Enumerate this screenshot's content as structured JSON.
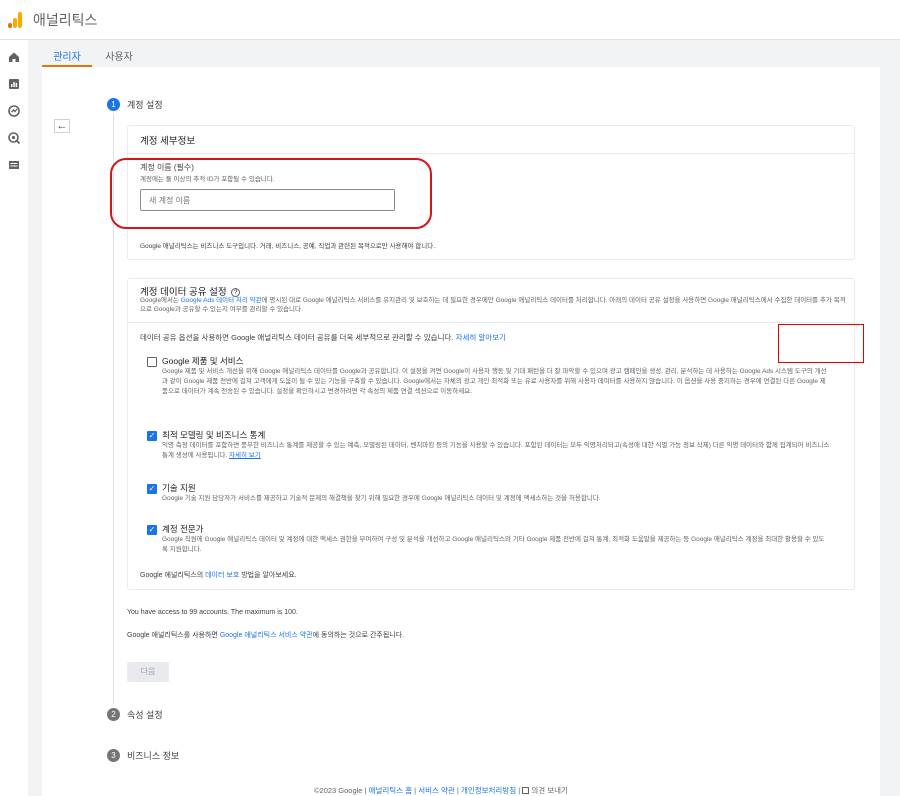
{
  "header": {
    "app_title": "애널리틱스"
  },
  "rail": {
    "icons": [
      "home-icon",
      "reports-icon",
      "explore-icon",
      "advertising-icon",
      "configure-icon",
      "settings-icon"
    ]
  },
  "tabs": [
    {
      "label": "관리자"
    },
    {
      "label": "사용자"
    }
  ],
  "steps": [
    {
      "number": "1",
      "label": "계정 설정"
    },
    {
      "number": "2",
      "label": "속성 설정"
    },
    {
      "number": "3",
      "label": "비즈니스 정보"
    }
  ],
  "account_details": {
    "title": "계정 세부정보",
    "name_label": "계정 이름 (필수)",
    "name_hint": "계정에는 둘 이상의 추적 ID가 포함될 수 있습니다.",
    "name_placeholder": "새 계정 이름",
    "footnote": "Google 애널리틱스는 비즈니스 도구입니다. 거래, 비즈니스, 공예, 직업과 관련된 목적으로만 사용해야 합니다."
  },
  "sharing": {
    "title": "계정 데이터 공유 설정",
    "intro_a": "Google에서는 ",
    "intro_link": "Google Ads 데이터 처리 약관",
    "intro_b": "에 명시된 대로 Google 애널리틱스 서비스를 유지관리 및 보호하는 데 필요한 경우에만 Google 애널리틱스 데이터를 처리합니다. 아래의 데이터 공유 설정을 사용하면 Google 애널리틱스에서 수집한 데이터를 추가 목적으로 Google과 공유할 수 있는지 여부를 관리할 수 있습니다.",
    "manage_text": "데이터 공유 옵션을 사용하면 Google 애널리틱스 데이터 공유를 더욱 세부적으로 관리할 수 있습니다. ",
    "manage_link": "자세히 알아보기",
    "options": [
      {
        "title": "Google 제품 및 서비스",
        "checked": false,
        "desc": "Google 제품 및 서비스 개선을 위해 Google 애널리틱스 데이터를 Google과 공유합니다. 이 설정을 켜면 Google이 사용자 행동 및 기대 패턴을 더 잘 파악할 수 있으며 광고 캠페인을 생성, 관리, 분석하는 데 사용하는 Google Ads 시스템 도구의 개선과 같이 Google 제품 전반에 걸쳐 고객에게 도움이 될 수 있는 기능을 구축할 수 있습니다. Google에서는 자체의 광고 개인 최적화 또는 유료 사용자를 위해 사용자 데이터를 사용하지 않습니다. 이 옵션을 사용 중지하는 경우에 연결된 다른 Google 제품으로 데이터가 계속 전송된 수 있습니다. 설정을 확인하시고 변경하려면 각 속성의 제품 연결 섹션으로 이동하세요."
      },
      {
        "title": "최적 모델링 및 비즈니스 통계",
        "checked": true,
        "desc_a": "익명 측정 데이터를 포함하면 풍부한 비즈니스 통계를 제공할 수 있는 예측, 모델링된 데이터, 벤치마킹 등의 기능을 사용할 수 있습니다. 포함된 데이터는 모두 익명처리되고(속성에 대한 식별 가능 정보 삭제) 다른 익명 데이터와 함께 집계되어 비즈니스 통계 생성에 사용됩니다. ",
        "desc_link": "자세히 보기"
      },
      {
        "title": "기술 지원",
        "checked": true,
        "desc": "Google 기술 지원 담당자가 서비스를 제공하고 기술적 문제의 해결책을 찾기 위해 필요한 경우에 Google 애널리틱스 데이터 및 계정에 액세스하는 것을 허용합니다."
      },
      {
        "title": "계정 전문가",
        "checked": true,
        "desc": "Google 직원에 Google 애널리틱스 데이터 및 계정에 대한 액세스 권한을 부여하여 구성 및 분석을 개선하고 Google 애널리틱스와 기타 Google 제품 전반에 걸쳐 통계, 최적화 도움말을 제공하는 등 Google 애널리틱스 계정을 최대한 활용할 수 있도록 지원합니다."
      }
    ],
    "protect_a": "Google 애널리틱스의 ",
    "protect_link": "데이터 보호",
    "protect_b": " 방법을 알아보세요."
  },
  "access_note": "You have access to 99 accounts. The maximum is 100.",
  "terms_a": "Google 애널리틱스를 사용하면 ",
  "terms_link": "Google 애널리틱스 서비스 약관",
  "terms_b": "에 동의하는 것으로 간주됩니다.",
  "next_label": "다음",
  "footer": {
    "copyright": "©2023 Google",
    "links": [
      "애널리틱스 홈",
      "서비스 약관",
      "개인정보처리방침"
    ],
    "feedback": "의견 보내기"
  },
  "colors": {
    "accent": "#1a73e8",
    "tab_underline": "#e37400",
    "annotation_red": "#d7131b"
  }
}
